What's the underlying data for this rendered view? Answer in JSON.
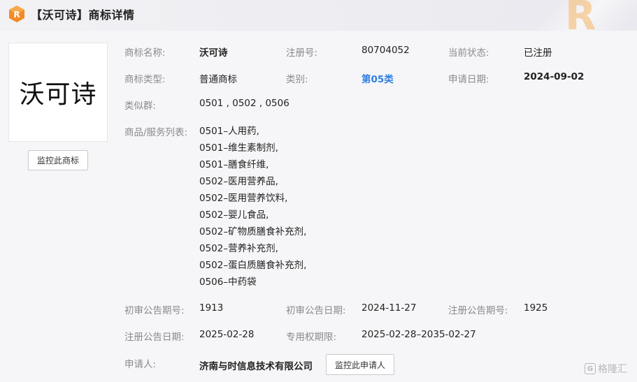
{
  "header": {
    "logo_letter": "R",
    "title": "【沃可诗】商标详情"
  },
  "thumbnail": {
    "text": "沃可诗"
  },
  "monitor_trademark_button": "监控此商标",
  "fields": {
    "name_label": "商标名称:",
    "name_value": "沃可诗",
    "reg_no_label": "注册号:",
    "reg_no_value": "80704052",
    "status_label": "当前状态:",
    "status_value": "已注册",
    "type_label": "商标类型:",
    "type_value": "普通商标",
    "class_label": "类别:",
    "class_value": "第05类",
    "apply_date_label": "申请日期:",
    "apply_date_value": "2024-09-02",
    "similar_label": "类似群:",
    "similar_value": "0501 , 0502 , 0506",
    "goods_label": "商品/服务列表:",
    "goods": [
      "0501–人用药,",
      "0501–维生素制剂,",
      "0501–膳食纤维,",
      "0502–医用营养品,",
      "0502–医用营养饮料,",
      "0502–婴儿食品,",
      "0502–矿物质膳食补充剂,",
      "0502–营养补充剂,",
      "0502–蛋白质膳食补充剂,",
      "0506–中药袋"
    ],
    "prelim_no_label": "初审公告期号:",
    "prelim_no_value": "1913",
    "prelim_date_label": "初审公告日期:",
    "prelim_date_value": "2024-11-27",
    "reg_pub_no_label": "注册公告期号:",
    "reg_pub_no_value": "1925",
    "reg_pub_date_label": "注册公告日期:",
    "reg_pub_date_value": "2025-02-28",
    "exclusive_label": "专用权期限:",
    "exclusive_value": "2025-02-28–2035-02-27",
    "applicant_label": "申请人:",
    "applicant_value": "济南与时信息技术有限公司"
  },
  "monitor_applicant_button": "监控此申请人",
  "watermark": {
    "icon_letter": "G",
    "text": "格隆汇"
  },
  "colors": {
    "link": "#2f7fe5",
    "label": "#8a8a8f",
    "accent": "#f08a24"
  }
}
